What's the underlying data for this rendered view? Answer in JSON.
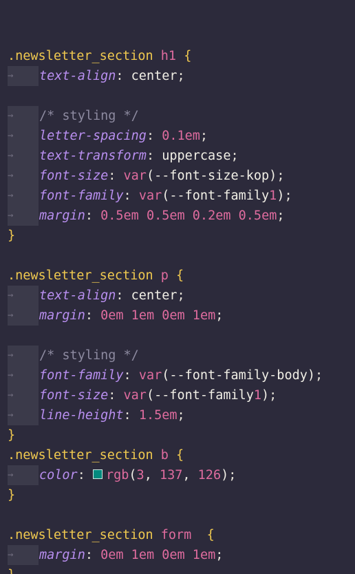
{
  "lines": [
    {
      "t": "blank"
    },
    {
      "t": "sel",
      "cls": ".newsletter_section",
      "tag": "h1",
      "brace": "{"
    },
    {
      "t": "decl",
      "prop": "text-align",
      "value": "center"
    },
    {
      "t": "blank"
    },
    {
      "t": "comment",
      "text": "/* styling */"
    },
    {
      "t": "decl",
      "prop": "letter-spacing",
      "value": "0.1em"
    },
    {
      "t": "decl",
      "prop": "text-transform",
      "value": "uppercase"
    },
    {
      "t": "decl",
      "prop": "font-size",
      "value": "var(--font-size-kop)"
    },
    {
      "t": "decl",
      "prop": "font-family",
      "value": "var(--font-family1)"
    },
    {
      "t": "decl",
      "prop": "margin",
      "value": "0.5em 0.5em 0.2em 0.5em"
    },
    {
      "t": "close",
      "brace": "}"
    },
    {
      "t": "blank"
    },
    {
      "t": "sel",
      "cls": ".newsletter_section",
      "tag": "p",
      "brace": "{"
    },
    {
      "t": "decl",
      "prop": "text-align",
      "value": "center"
    },
    {
      "t": "decl",
      "prop": "margin",
      "value": "0em 1em 0em 1em"
    },
    {
      "t": "blank"
    },
    {
      "t": "comment",
      "text": "/* styling */"
    },
    {
      "t": "decl",
      "prop": "font-family",
      "value": "var(--font-family-body)"
    },
    {
      "t": "decl",
      "prop": "font-size",
      "value": "var(--font-family1)"
    },
    {
      "t": "decl",
      "prop": "line-height",
      "value": "1.5em"
    },
    {
      "t": "close",
      "brace": "}"
    },
    {
      "t": "sel",
      "cls": ".newsletter_section",
      "tag": "b",
      "brace": "{"
    },
    {
      "t": "decl",
      "prop": "color",
      "value": "rgb(3, 137, 126)",
      "swatch": "#03897e"
    },
    {
      "t": "close",
      "brace": "}"
    },
    {
      "t": "blank"
    },
    {
      "t": "sel",
      "cls": ".newsletter_section",
      "tag": "form",
      "brace": " {"
    },
    {
      "t": "decl",
      "prop": "margin",
      "value": "0em 1em 0em 1em"
    },
    {
      "t": "close",
      "brace": "}"
    }
  ]
}
